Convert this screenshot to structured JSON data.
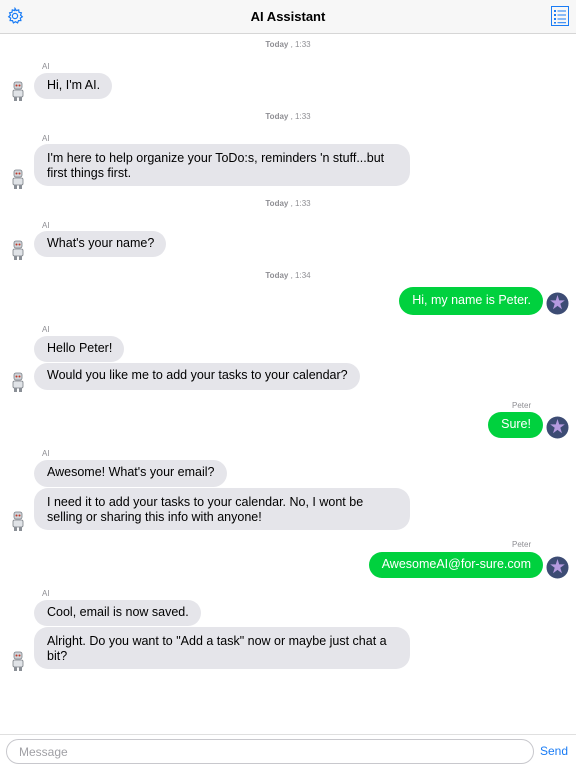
{
  "header": {
    "title": "AI Assistant"
  },
  "timestamps": [
    {
      "day": "Today",
      "time": ", 1:33"
    },
    {
      "day": "Today",
      "time": ", 1:33"
    },
    {
      "day": "Today",
      "time": ", 1:33"
    },
    {
      "day": "Today",
      "time": ", 1:34"
    }
  ],
  "senders": {
    "ai": "AI",
    "user": "Peter"
  },
  "messages": [
    "Hi, I'm AI.",
    "I'm here to help organize your ToDo:s, reminders 'n stuff...but first things first.",
    "What's your name?",
    "Hi, my name is Peter.",
    "Hello Peter!",
    "Would you like me to add your tasks to your calendar?",
    "Sure!",
    "Awesome! What's your email?",
    "I need it to add your tasks to your calendar. No, I wont be selling or sharing this info with anyone!",
    "AwesomeAI@for-sure.com",
    "Cool, email is now saved.",
    "Alright. Do you want to \"Add a task\" now or maybe just chat a bit?"
  ],
  "composer": {
    "placeholder": "Message",
    "send_label": "Send"
  },
  "colors": {
    "outgoing": "#00d13e",
    "incoming": "#e5e5ea",
    "accent": "#1a7cf5"
  },
  "icons": {
    "settings": "gear-icon",
    "menu": "list-icon",
    "ai_avatar": "robot-avatar",
    "user_avatar": "star-avatar"
  }
}
